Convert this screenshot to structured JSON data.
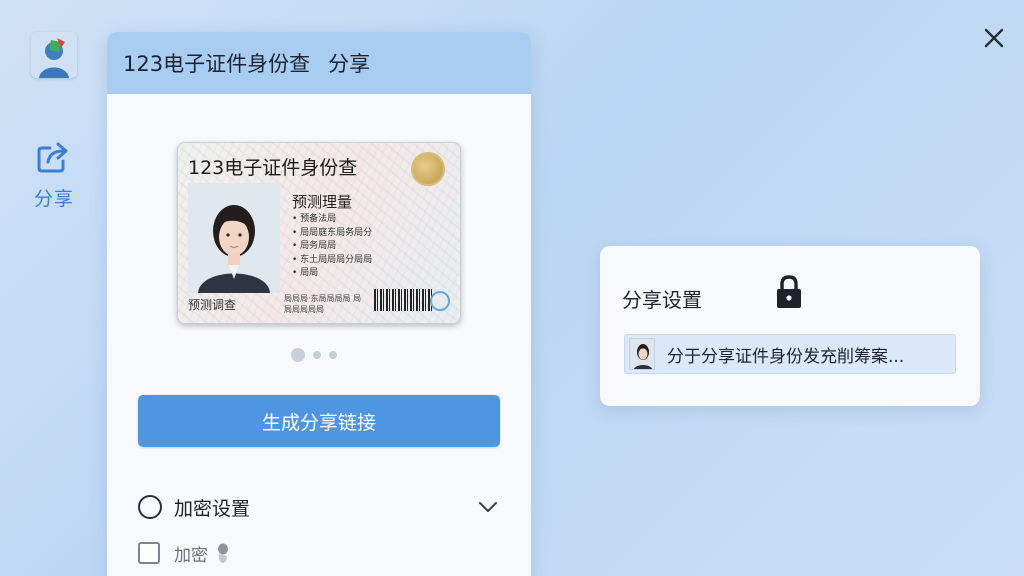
{
  "sidebar": {
    "share_label": "分享"
  },
  "panel": {
    "title": "123电子证件身份查",
    "title_suffix": "分享",
    "card": {
      "title": "123电子证件身份查",
      "name": "预测理量",
      "lines": [
        "• 预备法局",
        "• 局局庭东局务局分",
        "• 局务局局",
        "• 东土局局局分局局",
        "• 局局"
      ],
      "bottom_left": "预测调查",
      "bottom_mid": "局局局·东局局局局 局局局局局局"
    },
    "pager": {
      "count": 3,
      "active": 0
    },
    "generate_button": "生成分享链接",
    "encryption": {
      "label": "加密设置"
    },
    "encrypt_checkbox": {
      "label": "加密",
      "checked": false
    }
  },
  "share_settings": {
    "title": "分享设置",
    "item_text": "分于分享证件身份发充削筹案..."
  },
  "colors": {
    "accent": "#4f96e2",
    "header": "#a9ccf1",
    "share_icon": "#3a7fd5"
  },
  "icons": [
    "app-avatar-icon",
    "share-icon",
    "close-icon",
    "lock-icon",
    "chevron-down-icon",
    "touch-icon"
  ]
}
